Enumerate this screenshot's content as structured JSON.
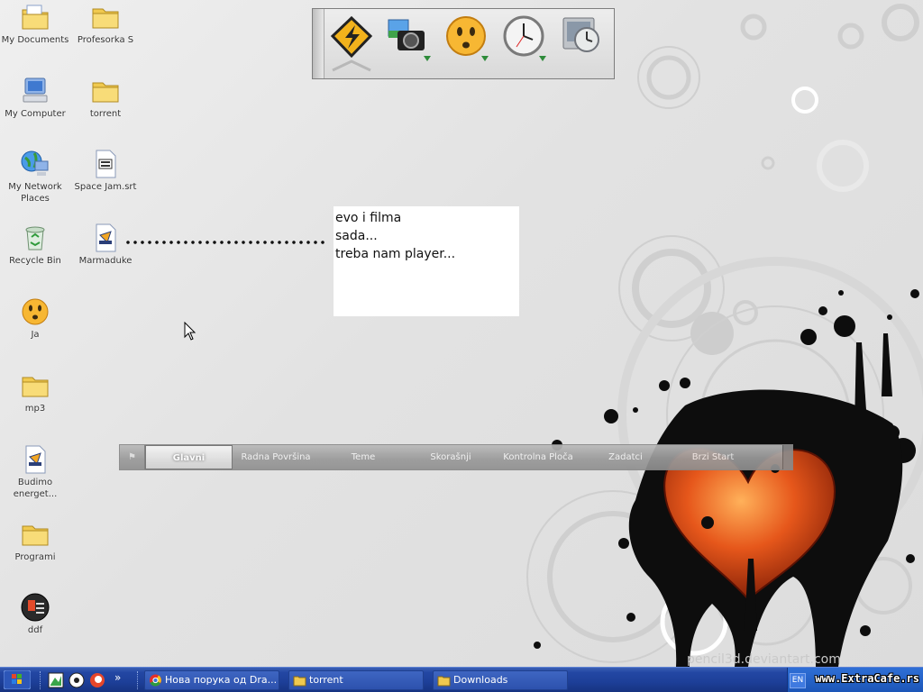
{
  "desktop": {
    "icons": [
      {
        "label": "My Documents",
        "icon": "my-documents-icon"
      },
      {
        "label": "Profesorka S",
        "icon": "folder-icon"
      },
      {
        "label": "My Computer",
        "icon": "my-computer-icon"
      },
      {
        "label": "torrent",
        "icon": "folder-icon"
      },
      {
        "label": "My Network Places",
        "icon": "network-places-icon"
      },
      {
        "label": "Space Jam.srt",
        "icon": "subtitle-file-icon"
      },
      {
        "label": "Recycle Bin",
        "icon": "recycle-bin-icon"
      },
      {
        "label": "Marmaduke",
        "icon": "media-file-icon"
      },
      {
        "label": "Ja",
        "icon": "smiley-icon"
      },
      {
        "label": "mp3",
        "icon": "folder-icon"
      },
      {
        "label": "Budimo energet...",
        "icon": "media-file-icon"
      },
      {
        "label": "Programi",
        "icon": "folder-icon"
      },
      {
        "label": "ddf",
        "icon": "document-icon"
      }
    ]
  },
  "dock": {
    "items": [
      {
        "icon": "winamp-icon"
      },
      {
        "icon": "camera-icon"
      },
      {
        "icon": "smiley-icon"
      },
      {
        "icon": "clock-icon"
      },
      {
        "icon": "monitor-clock-icon"
      }
    ]
  },
  "note": {
    "lines": [
      "evo i filma",
      "sada...",
      "treba nam player..."
    ]
  },
  "tabbar": {
    "tabs": [
      {
        "label": "Glavni",
        "active": true
      },
      {
        "label": "Radna Površina"
      },
      {
        "label": "Teme"
      },
      {
        "label": "Skorašnji"
      },
      {
        "label": "Kontrolna Ploča"
      },
      {
        "label": "Zadatci"
      },
      {
        "label": "Brzi Start"
      }
    ]
  },
  "taskbar": {
    "tasks": [
      {
        "label": "Нова порука од Dra...",
        "icon": "chrome-icon"
      },
      {
        "label": "torrent",
        "icon": "folder-icon"
      },
      {
        "label": "Downloads",
        "icon": "folder-icon"
      }
    ],
    "language": "EN",
    "watermark": "www.ExtraCafe.rs",
    "overflow": "»"
  },
  "colors": {
    "taskbar": "#1d3f98",
    "tray": "#1c56b8",
    "heart": "#e2571c",
    "splatter": "#0d0d0d"
  }
}
